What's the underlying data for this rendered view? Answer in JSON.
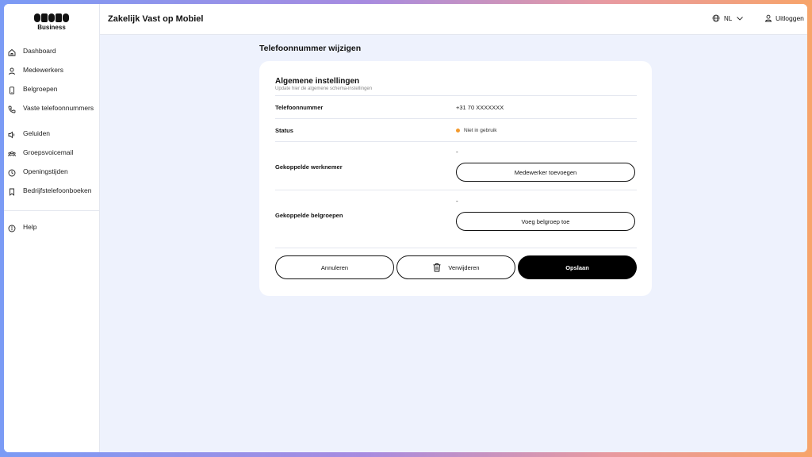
{
  "brand": {
    "sub": "Business"
  },
  "sidebar": {
    "items": [
      {
        "label": "Dashboard"
      },
      {
        "label": "Medewerkers"
      },
      {
        "label": "Belgroepen"
      },
      {
        "label": "Vaste telefoonnummers"
      },
      {
        "label": "Geluiden"
      },
      {
        "label": "Groepsvoicemail"
      },
      {
        "label": "Openingstijden"
      },
      {
        "label": "Bedrijfstelefoonboeken"
      }
    ],
    "help": "Help"
  },
  "header": {
    "title": "Zakelijk Vast op Mobiel",
    "language": "NL",
    "logout": "Uitloggen"
  },
  "main": {
    "title": "Telefoonnummer wijzigen",
    "section": {
      "title": "Algemene instellingen",
      "subtitle": "Update hier de algemene schema-instellingen"
    },
    "fields": {
      "phone_label": "Telefoonnummer",
      "phone_value": "+31 70 XXXXXXX",
      "status_label": "Status",
      "status_value": "Niet in gebruik",
      "employee_label": "Gekoppelde werknemer",
      "employee_value": "-",
      "employee_button": "Medewerker toevoegen",
      "group_label": "Gekoppelde belgroepen",
      "group_value": "-",
      "group_button": "Voeg belgroep toe"
    },
    "actions": {
      "cancel": "Annuleren",
      "delete": "Verwijderen",
      "save": "Opslaan"
    }
  },
  "colors": {
    "status_dot": "#f39a2d",
    "background": "#eef2fd"
  }
}
